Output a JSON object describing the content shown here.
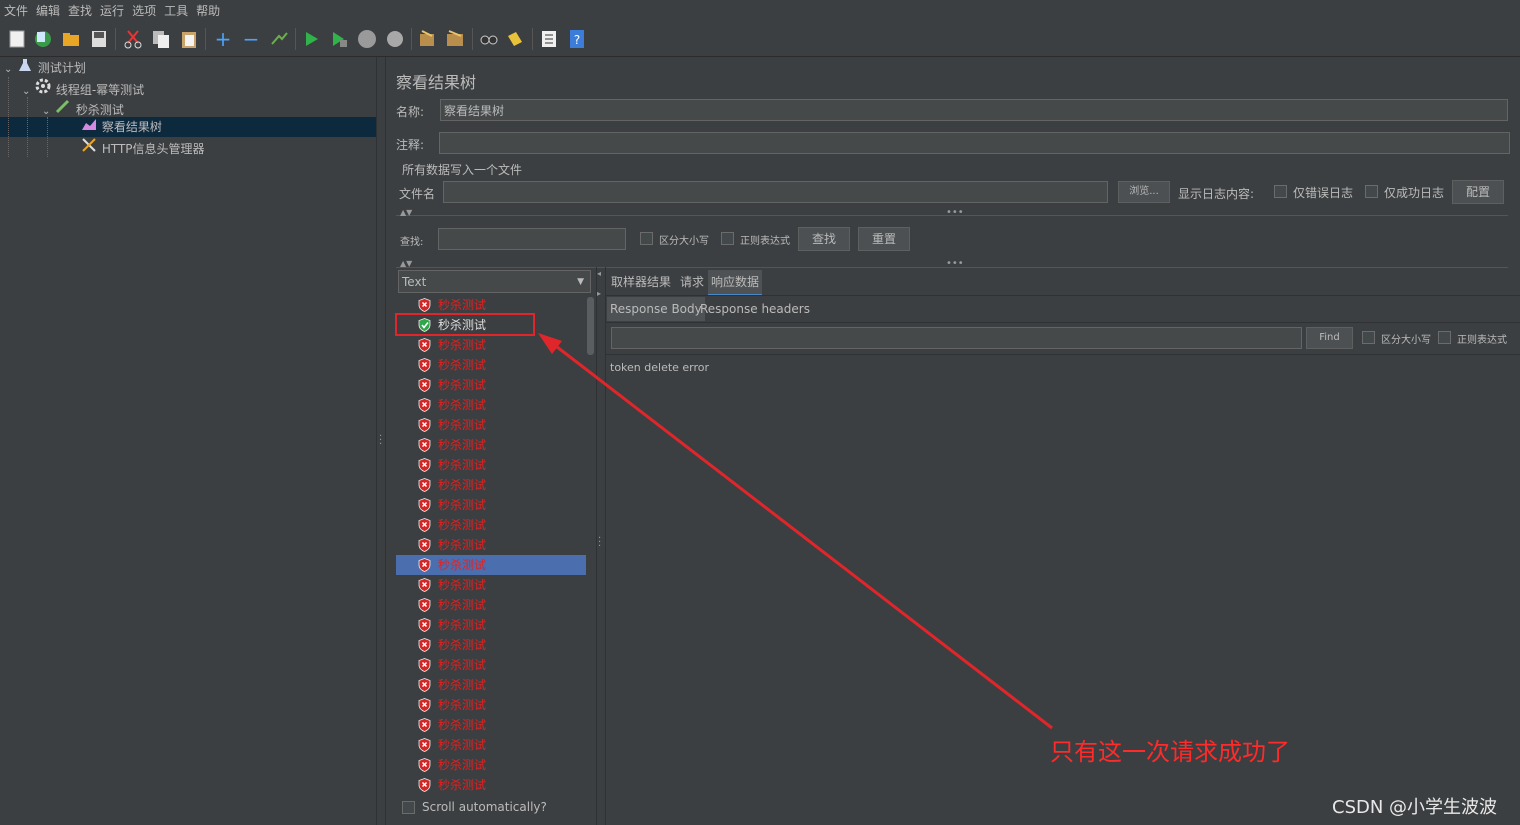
{
  "menu": [
    "文件",
    "编辑",
    "查找",
    "运行",
    "选项",
    "工具",
    "帮助"
  ],
  "toolbar_icons": [
    "new-icon",
    "templates-icon",
    "open-icon",
    "save-icon",
    "cut-icon",
    "copy-icon",
    "paste-icon",
    "expand-icon",
    "collapse-icon",
    "toggle-icon",
    "start-icon",
    "start-no-pause-icon",
    "stop-icon",
    "shutdown-icon",
    "clear-icon",
    "clear-all-icon",
    "search-icon",
    "reset-search-icon",
    "function-helper-icon",
    "help-icon"
  ],
  "tree": {
    "items": [
      {
        "label": "测试计划",
        "icon": "flask-icon"
      },
      {
        "label": "线程组-幂等测试",
        "icon": "gear-icon"
      },
      {
        "label": "秒杀测试",
        "icon": "pipette-icon"
      },
      {
        "label": "察看结果树",
        "icon": "chart-icon"
      },
      {
        "label": "HTTP信息头管理器",
        "icon": "wrench-icon"
      }
    ]
  },
  "panel": {
    "title": "察看结果树",
    "name_label": "名称:",
    "name_value": "察看结果树",
    "comment_label": "注释:",
    "comment_value": "",
    "file_section": "所有数据写入一个文件",
    "filename_label": "文件名",
    "filename_value": "",
    "browse": "浏览...",
    "log_content_label": "显示日志内容:",
    "errors_only": "仅错误日志",
    "success_only": "仅成功日志",
    "configure": "配置",
    "search_label": "查找:",
    "search_value": "",
    "case_sensitive": "区分大小写",
    "regex": "正则表达式",
    "find_btn": "查找",
    "reset_btn": "重置",
    "renderer": "Text",
    "scroll_auto": "Scroll automatically?",
    "tabs": [
      "取样器结果",
      "请求",
      "响应数据"
    ],
    "subtabs": [
      "Response Body",
      "Response headers"
    ],
    "find_small": "Find",
    "case_small": "区分大小写",
    "regex_small": "正则表达式",
    "response_text": "token delete error"
  },
  "results": {
    "label": "秒杀测试",
    "statuses": [
      "bad",
      "good",
      "bad",
      "bad",
      "bad",
      "bad",
      "bad",
      "bad",
      "bad",
      "bad",
      "bad",
      "bad",
      "bad",
      "bad",
      "bad",
      "bad",
      "bad",
      "bad",
      "bad",
      "bad",
      "bad",
      "bad",
      "bad",
      "bad",
      "bad"
    ],
    "selected_index": 13
  },
  "annotation": "只有这一次请求成功了",
  "watermark": "CSDN @小学生波波"
}
